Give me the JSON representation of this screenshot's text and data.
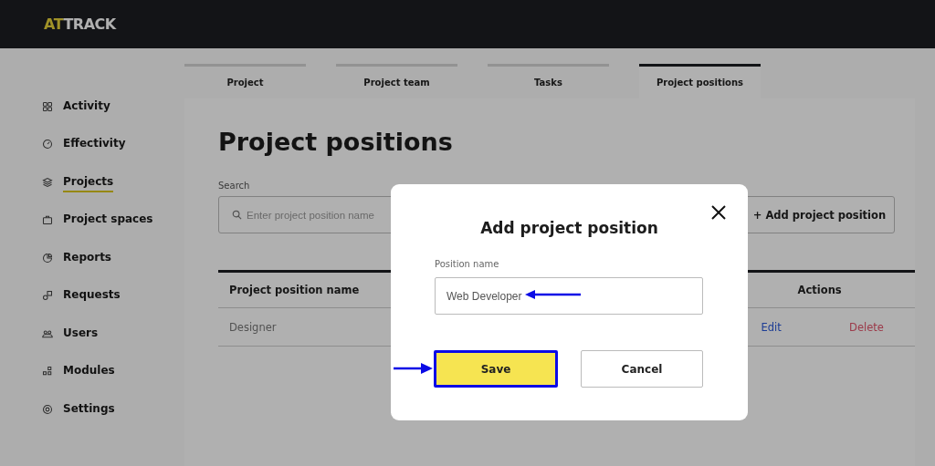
{
  "logo": {
    "accent": "AT",
    "rest": "TRACK"
  },
  "sidebar": {
    "items": [
      {
        "label": "Activity",
        "selected": false
      },
      {
        "label": "Effectivity",
        "selected": false
      },
      {
        "label": "Projects",
        "selected": true
      },
      {
        "label": "Project spaces",
        "selected": false
      },
      {
        "label": "Reports",
        "selected": false
      },
      {
        "label": "Requests",
        "selected": false
      },
      {
        "label": "Users",
        "selected": false
      },
      {
        "label": "Modules",
        "selected": false
      },
      {
        "label": "Settings",
        "selected": false
      }
    ]
  },
  "tabs": [
    {
      "label": "Project",
      "selected": false
    },
    {
      "label": "Project team",
      "selected": false
    },
    {
      "label": "Tasks",
      "selected": false
    },
    {
      "label": "Project positions",
      "selected": true
    }
  ],
  "page": {
    "title": "Project positions",
    "search": {
      "label": "Search",
      "placeholder": "Enter project position name"
    },
    "add_button": "+ Add project position"
  },
  "table": {
    "columns": [
      "Project position name",
      "Actions"
    ],
    "rows": [
      {
        "name": "Designer",
        "edit": "Edit",
        "delete": "Delete"
      }
    ]
  },
  "dialog": {
    "title": "Add project position",
    "field_label": "Position name",
    "field_value": "Web Developer",
    "buttons": [
      {
        "label": "Save",
        "kind": "primary"
      },
      {
        "label": "Cancel",
        "kind": "secondary"
      }
    ]
  }
}
